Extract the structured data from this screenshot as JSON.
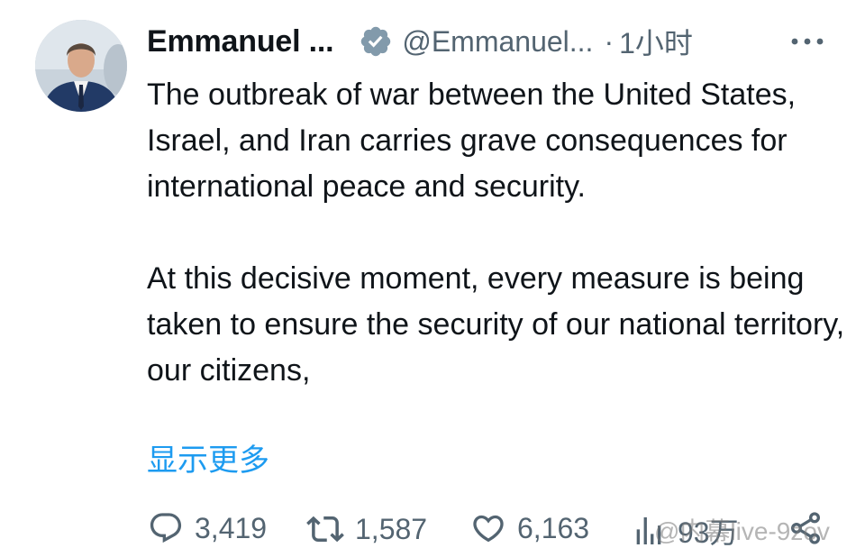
{
  "author": {
    "display_name": "Emmanuel ...",
    "handle": "@Emmanuel...",
    "separator": "·",
    "time": "1小时",
    "verified": true
  },
  "tweet": {
    "paragraphs": [
      "The outbreak of war between the United States, Israel, and Iran carries grave consequences for international peace and security.",
      "At this decisive moment, every measure is being taken to ensure the security of our national territory, our citizens,"
    ],
    "show_more": "显示更多"
  },
  "actions": {
    "replies": "3,419",
    "reposts": "1,587",
    "likes": "6,163",
    "views": "93万"
  },
  "watermark": "@内幕live-9zov",
  "colors": {
    "text": "#0f1419",
    "secondary": "#536471",
    "link": "#1d9bf0",
    "verified_badge": "#829aab"
  },
  "icons": [
    "verified-badge-icon",
    "more-icon",
    "reply-icon",
    "repost-icon",
    "like-icon",
    "views-icon",
    "share-icon"
  ]
}
